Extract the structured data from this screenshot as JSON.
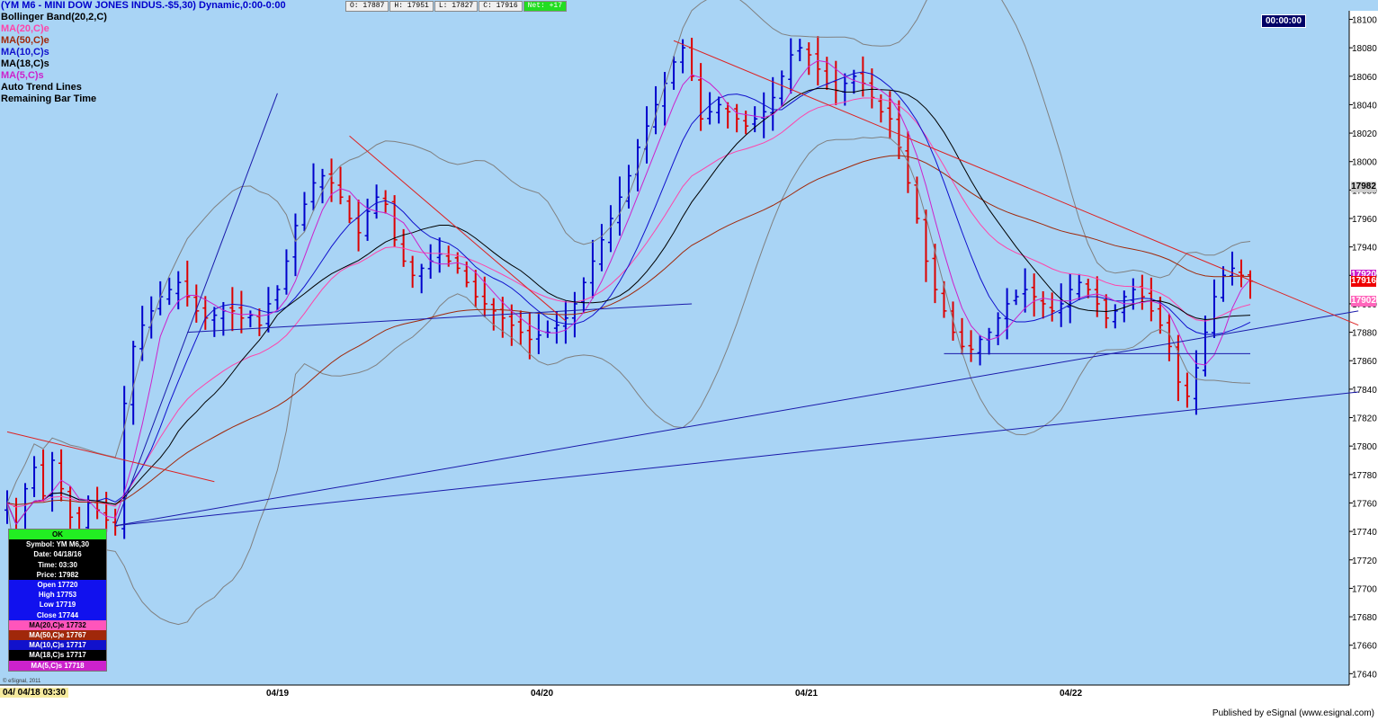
{
  "header": {
    "title": "(YM M6 - MINI DOW JONES INDUS.-$5,30) Dynamic,0:00-0:00",
    "title_color": "#0000cc"
  },
  "ohlc_bar": {
    "open": "O: 17887",
    "high": "H: 17951",
    "low": "L: 17827",
    "close": "C: 17916",
    "net": "Net: +17"
  },
  "legend": [
    {
      "label": "Bollinger Band(20,2,C)",
      "color": "#000000"
    },
    {
      "label": "MA(20,C)e",
      "color": "#ff44aa"
    },
    {
      "label": "MA(50,C)e",
      "color": "#a0280a"
    },
    {
      "label": "MA(10,C)s",
      "color": "#1010cc"
    },
    {
      "label": "MA(18,C)s",
      "color": "#000000"
    },
    {
      "label": "MA(5,C)s",
      "color": "#cc22cc"
    },
    {
      "label": "Auto Trend Lines",
      "color": "#000000"
    },
    {
      "label": "Remaining Bar Time",
      "color": "#000000"
    }
  ],
  "timer": "00:00:00",
  "info_box": {
    "ok": "OK",
    "symbol": "Symbol: YM M6,30",
    "date": "Date: 04/18/16",
    "time": "Time: 03:30",
    "price": "Price: 17982",
    "open": "Open 17720",
    "high": "High 17753",
    "low": "Low 17719",
    "close": "Close 17744",
    "ma20": "MA(20,C)e 17732",
    "ma50": "MA(50,C)e 17767",
    "ma10": "MA(10,C)s 17717",
    "ma18": "MA(18,C)s 17717",
    "ma5": "MA(5,C)s 17718"
  },
  "x_axis": {
    "first_label": "04/ 04/18 03:30",
    "date_labels": [
      "04/19",
      "04/20",
      "04/21",
      "04/22"
    ]
  },
  "footer": {
    "published": "Published by eSignal (www.esignal.com)",
    "copyright": "© eSignal, 2011"
  },
  "price_tags": [
    {
      "value": "17982",
      "bg": "#cccccc",
      "fg": "#000000"
    },
    {
      "value": "17920",
      "bg": "#cc22cc",
      "fg": "#ffffff"
    },
    {
      "value": "17916",
      "bg": "#ee0000",
      "fg": "#ffffff"
    },
    {
      "value": "17902",
      "bg": "#ff66bb",
      "fg": "#ffffff"
    }
  ],
  "colors": {
    "background": "#a9d4f5",
    "up_bar": "#0000cc",
    "down_bar": "#dd0000",
    "bollinger": "#808080",
    "trend_red": "#dd2222",
    "trend_blue": "#1a1aaa"
  },
  "chart_data": {
    "type": "line",
    "chart_style": "ohlc-bars",
    "title": "(YM M6 - MINI DOW JONES INDUS.-$5,30) Dynamic,0:00-0:00",
    "y_ticks": [
      18100,
      18080,
      18060,
      18040,
      18020,
      18000,
      17980,
      17960,
      17940,
      17920,
      17900,
      17880,
      17860,
      17840,
      17820,
      17800,
      17780,
      17760,
      17740,
      17720,
      17700,
      17680,
      17660,
      17640
    ],
    "ylim": [
      17632,
      18106
    ],
    "x_date_labels": [
      "04/19",
      "04/20",
      "04/21",
      "04/22"
    ],
    "grid": false,
    "close_path": [
      17760,
      17730,
      17770,
      17785,
      17765,
      17790,
      17770,
      17750,
      17740,
      17760,
      17755,
      17748,
      17744,
      17830,
      17870,
      17885,
      17895,
      17905,
      17910,
      17915,
      17905,
      17895,
      17890,
      17892,
      17895,
      17895,
      17890,
      17892,
      17885,
      17900,
      17910,
      17930,
      17955,
      17970,
      17985,
      17990,
      17985,
      17975,
      17960,
      17950,
      17965,
      17975,
      17970,
      17945,
      17930,
      17920,
      17925,
      17930,
      17935,
      17930,
      17925,
      17915,
      17905,
      17900,
      17895,
      17890,
      17885,
      17880,
      17875,
      17878,
      17880,
      17885,
      17890,
      17900,
      17915,
      17930,
      17945,
      17960,
      17975,
      17990,
      18010,
      18025,
      18040,
      18055,
      18070,
      18080,
      18060,
      18030,
      18035,
      18040,
      18035,
      18030,
      18025,
      18030,
      18035,
      18045,
      18060,
      18075,
      18080,
      18075,
      18065,
      18055,
      18050,
      18055,
      18060,
      18055,
      18045,
      18035,
      18030,
      18010,
      17985,
      17960,
      17930,
      17910,
      17895,
      17880,
      17870,
      17868,
      17875,
      17880,
      17890,
      17900,
      17905,
      17910,
      17905,
      17900,
      17895,
      17900,
      17910,
      17915,
      17910,
      17900,
      17890,
      17895,
      17905,
      17910,
      17905,
      17895,
      17885,
      17870,
      17845,
      17835,
      17855,
      17880,
      17905,
      17920,
      17925,
      17920,
      17916
    ],
    "moving_averages": [
      {
        "name": "MA(20,C)e",
        "period": 20,
        "kind": "ema",
        "color": "#ff44aa"
      },
      {
        "name": "MA(50,C)e",
        "period": 50,
        "kind": "ema",
        "color": "#a0280a"
      },
      {
        "name": "MA(10,C)s",
        "period": 10,
        "kind": "sma",
        "color": "#1010cc"
      },
      {
        "name": "MA(18,C)s",
        "period": 18,
        "kind": "sma",
        "color": "#000000"
      },
      {
        "name": "MA(5,C)s",
        "period": 5,
        "kind": "sma",
        "color": "#cc22cc"
      }
    ],
    "bollinger": {
      "period": 20,
      "k": 2
    }
  }
}
